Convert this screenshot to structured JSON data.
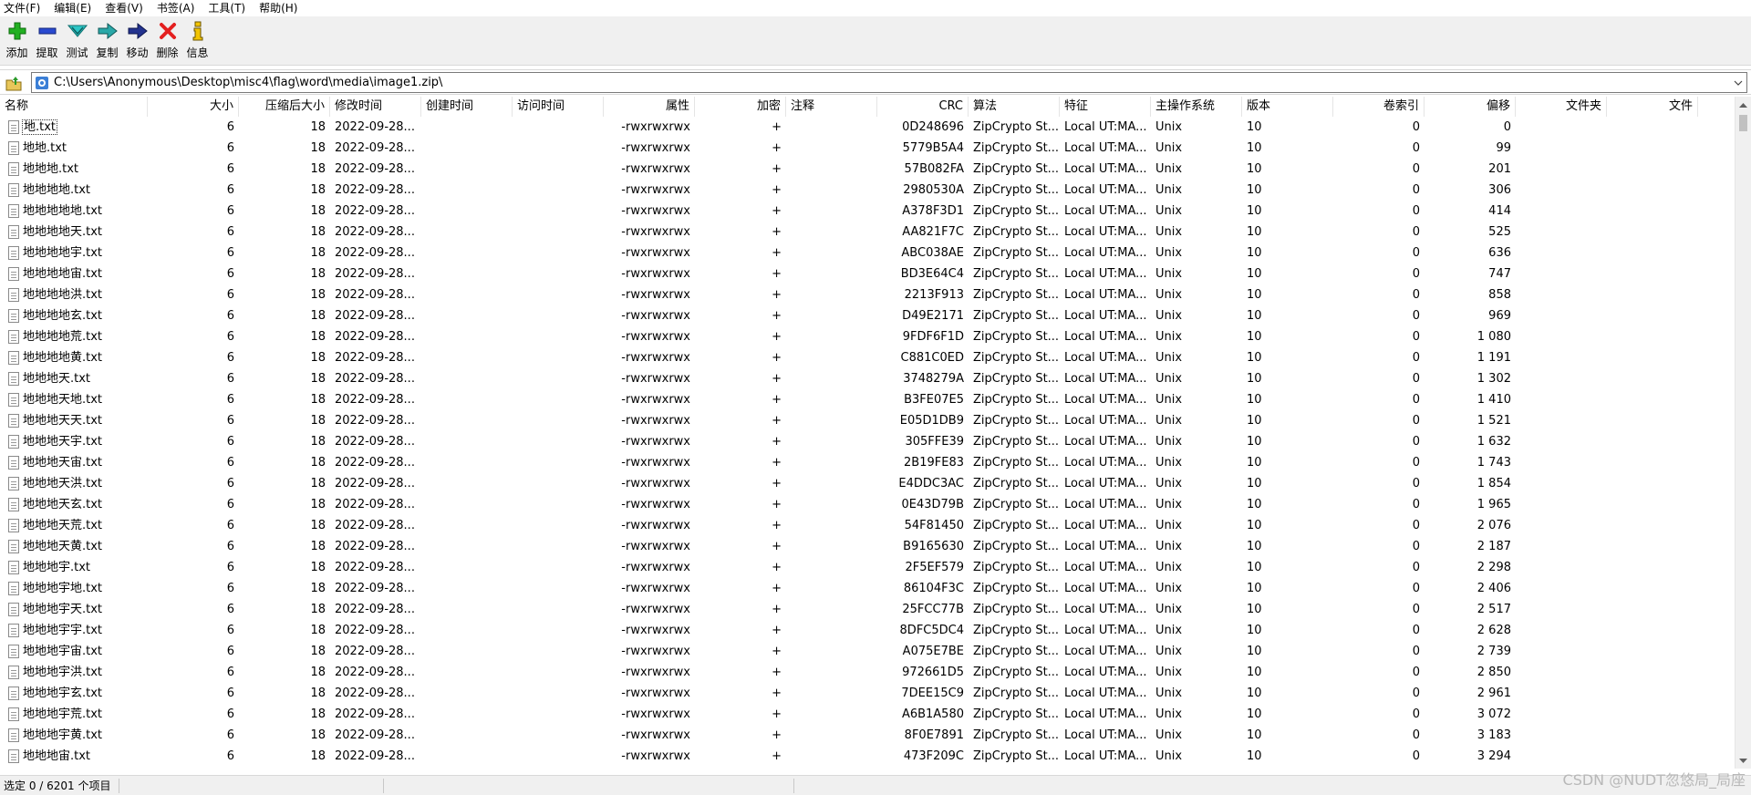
{
  "menu": [
    "文件(F)",
    "编辑(E)",
    "查看(V)",
    "书签(A)",
    "工具(T)",
    "帮助(H)"
  ],
  "toolbar": [
    {
      "label": "添加",
      "icon": "plus-icon",
      "color": "#1aa01a"
    },
    {
      "label": "提取",
      "icon": "minus-icon",
      "color": "#1f3fb5"
    },
    {
      "label": "测试",
      "icon": "check-icon",
      "color": "#20b0b0"
    },
    {
      "label": "复制",
      "icon": "copy-arrow-icon",
      "color": "#20a0a0"
    },
    {
      "label": "移动",
      "icon": "move-arrow-icon",
      "color": "#1f2f8f"
    },
    {
      "label": "删除",
      "icon": "delete-icon",
      "color": "#e02020"
    },
    {
      "label": "信息",
      "icon": "info-icon",
      "color": "#c8a000"
    }
  ],
  "address": {
    "path": "C:\\Users\\Anonymous\\Desktop\\misc4\\flag\\word\\media\\image1.zip\\"
  },
  "columns": [
    "名称",
    "大小",
    "压缩后大小",
    "修改时间",
    "创建时间",
    "访问时间",
    "属性",
    "加密",
    "注释",
    "CRC",
    "算法",
    "特征",
    "主操作系统",
    "版本",
    "卷索引",
    "偏移",
    "文件夹",
    "文件"
  ],
  "rows": [
    {
      "name": "地.txt",
      "size": "6",
      "packed": "18",
      "modified": "2022-09-28...",
      "attr": "-rwxrwxrwx",
      "enc": "+",
      "crc": "0D248696",
      "method": "ZipCrypto St...",
      "char": "Local UT:MA...",
      "os": "Unix",
      "ver": "10",
      "vol": "0",
      "offset": "0"
    },
    {
      "name": "地地.txt",
      "size": "6",
      "packed": "18",
      "modified": "2022-09-28...",
      "attr": "-rwxrwxrwx",
      "enc": "+",
      "crc": "5779B5A4",
      "method": "ZipCrypto St...",
      "char": "Local UT:MA...",
      "os": "Unix",
      "ver": "10",
      "vol": "0",
      "offset": "99"
    },
    {
      "name": "地地地.txt",
      "size": "6",
      "packed": "18",
      "modified": "2022-09-28...",
      "attr": "-rwxrwxrwx",
      "enc": "+",
      "crc": "57B082FA",
      "method": "ZipCrypto St...",
      "char": "Local UT:MA...",
      "os": "Unix",
      "ver": "10",
      "vol": "0",
      "offset": "201"
    },
    {
      "name": "地地地地.txt",
      "size": "6",
      "packed": "18",
      "modified": "2022-09-28...",
      "attr": "-rwxrwxrwx",
      "enc": "+",
      "crc": "2980530A",
      "method": "ZipCrypto St...",
      "char": "Local UT:MA...",
      "os": "Unix",
      "ver": "10",
      "vol": "0",
      "offset": "306"
    },
    {
      "name": "地地地地地.txt",
      "size": "6",
      "packed": "18",
      "modified": "2022-09-28...",
      "attr": "-rwxrwxrwx",
      "enc": "+",
      "crc": "A378F3D1",
      "method": "ZipCrypto St...",
      "char": "Local UT:MA...",
      "os": "Unix",
      "ver": "10",
      "vol": "0",
      "offset": "414"
    },
    {
      "name": "地地地地天.txt",
      "size": "6",
      "packed": "18",
      "modified": "2022-09-28...",
      "attr": "-rwxrwxrwx",
      "enc": "+",
      "crc": "AA821F7C",
      "method": "ZipCrypto St...",
      "char": "Local UT:MA...",
      "os": "Unix",
      "ver": "10",
      "vol": "0",
      "offset": "525"
    },
    {
      "name": "地地地地宇.txt",
      "size": "6",
      "packed": "18",
      "modified": "2022-09-28...",
      "attr": "-rwxrwxrwx",
      "enc": "+",
      "crc": "ABC038AE",
      "method": "ZipCrypto St...",
      "char": "Local UT:MA...",
      "os": "Unix",
      "ver": "10",
      "vol": "0",
      "offset": "636"
    },
    {
      "name": "地地地地宙.txt",
      "size": "6",
      "packed": "18",
      "modified": "2022-09-28...",
      "attr": "-rwxrwxrwx",
      "enc": "+",
      "crc": "BD3E64C4",
      "method": "ZipCrypto St...",
      "char": "Local UT:MA...",
      "os": "Unix",
      "ver": "10",
      "vol": "0",
      "offset": "747"
    },
    {
      "name": "地地地地洪.txt",
      "size": "6",
      "packed": "18",
      "modified": "2022-09-28...",
      "attr": "-rwxrwxrwx",
      "enc": "+",
      "crc": "2213F913",
      "method": "ZipCrypto St...",
      "char": "Local UT:MA...",
      "os": "Unix",
      "ver": "10",
      "vol": "0",
      "offset": "858"
    },
    {
      "name": "地地地地玄.txt",
      "size": "6",
      "packed": "18",
      "modified": "2022-09-28...",
      "attr": "-rwxrwxrwx",
      "enc": "+",
      "crc": "D49E2171",
      "method": "ZipCrypto St...",
      "char": "Local UT:MA...",
      "os": "Unix",
      "ver": "10",
      "vol": "0",
      "offset": "969"
    },
    {
      "name": "地地地地荒.txt",
      "size": "6",
      "packed": "18",
      "modified": "2022-09-28...",
      "attr": "-rwxrwxrwx",
      "enc": "+",
      "crc": "9FDF6F1D",
      "method": "ZipCrypto St...",
      "char": "Local UT:MA...",
      "os": "Unix",
      "ver": "10",
      "vol": "0",
      "offset": "1 080"
    },
    {
      "name": "地地地地黄.txt",
      "size": "6",
      "packed": "18",
      "modified": "2022-09-28...",
      "attr": "-rwxrwxrwx",
      "enc": "+",
      "crc": "C881C0ED",
      "method": "ZipCrypto St...",
      "char": "Local UT:MA...",
      "os": "Unix",
      "ver": "10",
      "vol": "0",
      "offset": "1 191"
    },
    {
      "name": "地地地天.txt",
      "size": "6",
      "packed": "18",
      "modified": "2022-09-28...",
      "attr": "-rwxrwxrwx",
      "enc": "+",
      "crc": "3748279A",
      "method": "ZipCrypto St...",
      "char": "Local UT:MA...",
      "os": "Unix",
      "ver": "10",
      "vol": "0",
      "offset": "1 302"
    },
    {
      "name": "地地地天地.txt",
      "size": "6",
      "packed": "18",
      "modified": "2022-09-28...",
      "attr": "-rwxrwxrwx",
      "enc": "+",
      "crc": "B3FE07E5",
      "method": "ZipCrypto St...",
      "char": "Local UT:MA...",
      "os": "Unix",
      "ver": "10",
      "vol": "0",
      "offset": "1 410"
    },
    {
      "name": "地地地天天.txt",
      "size": "6",
      "packed": "18",
      "modified": "2022-09-28...",
      "attr": "-rwxrwxrwx",
      "enc": "+",
      "crc": "E05D1DB9",
      "method": "ZipCrypto St...",
      "char": "Local UT:MA...",
      "os": "Unix",
      "ver": "10",
      "vol": "0",
      "offset": "1 521"
    },
    {
      "name": "地地地天宇.txt",
      "size": "6",
      "packed": "18",
      "modified": "2022-09-28...",
      "attr": "-rwxrwxrwx",
      "enc": "+",
      "crc": "305FFE39",
      "method": "ZipCrypto St...",
      "char": "Local UT:MA...",
      "os": "Unix",
      "ver": "10",
      "vol": "0",
      "offset": "1 632"
    },
    {
      "name": "地地地天宙.txt",
      "size": "6",
      "packed": "18",
      "modified": "2022-09-28...",
      "attr": "-rwxrwxrwx",
      "enc": "+",
      "crc": "2B19FE83",
      "method": "ZipCrypto St...",
      "char": "Local UT:MA...",
      "os": "Unix",
      "ver": "10",
      "vol": "0",
      "offset": "1 743"
    },
    {
      "name": "地地地天洪.txt",
      "size": "6",
      "packed": "18",
      "modified": "2022-09-28...",
      "attr": "-rwxrwxrwx",
      "enc": "+",
      "crc": "E4DDC3AC",
      "method": "ZipCrypto St...",
      "char": "Local UT:MA...",
      "os": "Unix",
      "ver": "10",
      "vol": "0",
      "offset": "1 854"
    },
    {
      "name": "地地地天玄.txt",
      "size": "6",
      "packed": "18",
      "modified": "2022-09-28...",
      "attr": "-rwxrwxrwx",
      "enc": "+",
      "crc": "0E43D79B",
      "method": "ZipCrypto St...",
      "char": "Local UT:MA...",
      "os": "Unix",
      "ver": "10",
      "vol": "0",
      "offset": "1 965"
    },
    {
      "name": "地地地天荒.txt",
      "size": "6",
      "packed": "18",
      "modified": "2022-09-28...",
      "attr": "-rwxrwxrwx",
      "enc": "+",
      "crc": "54F81450",
      "method": "ZipCrypto St...",
      "char": "Local UT:MA...",
      "os": "Unix",
      "ver": "10",
      "vol": "0",
      "offset": "2 076"
    },
    {
      "name": "地地地天黄.txt",
      "size": "6",
      "packed": "18",
      "modified": "2022-09-28...",
      "attr": "-rwxrwxrwx",
      "enc": "+",
      "crc": "B9165630",
      "method": "ZipCrypto St...",
      "char": "Local UT:MA...",
      "os": "Unix",
      "ver": "10",
      "vol": "0",
      "offset": "2 187"
    },
    {
      "name": "地地地宇.txt",
      "size": "6",
      "packed": "18",
      "modified": "2022-09-28...",
      "attr": "-rwxrwxrwx",
      "enc": "+",
      "crc": "2F5EF579",
      "method": "ZipCrypto St...",
      "char": "Local UT:MA...",
      "os": "Unix",
      "ver": "10",
      "vol": "0",
      "offset": "2 298"
    },
    {
      "name": "地地地宇地.txt",
      "size": "6",
      "packed": "18",
      "modified": "2022-09-28...",
      "attr": "-rwxrwxrwx",
      "enc": "+",
      "crc": "86104F3C",
      "method": "ZipCrypto St...",
      "char": "Local UT:MA...",
      "os": "Unix",
      "ver": "10",
      "vol": "0",
      "offset": "2 406"
    },
    {
      "name": "地地地宇天.txt",
      "size": "6",
      "packed": "18",
      "modified": "2022-09-28...",
      "attr": "-rwxrwxrwx",
      "enc": "+",
      "crc": "25FCC77B",
      "method": "ZipCrypto St...",
      "char": "Local UT:MA...",
      "os": "Unix",
      "ver": "10",
      "vol": "0",
      "offset": "2 517"
    },
    {
      "name": "地地地宇宇.txt",
      "size": "6",
      "packed": "18",
      "modified": "2022-09-28...",
      "attr": "-rwxrwxrwx",
      "enc": "+",
      "crc": "8DFC5DC4",
      "method": "ZipCrypto St...",
      "char": "Local UT:MA...",
      "os": "Unix",
      "ver": "10",
      "vol": "0",
      "offset": "2 628"
    },
    {
      "name": "地地地宇宙.txt",
      "size": "6",
      "packed": "18",
      "modified": "2022-09-28...",
      "attr": "-rwxrwxrwx",
      "enc": "+",
      "crc": "A075E7BE",
      "method": "ZipCrypto St...",
      "char": "Local UT:MA...",
      "os": "Unix",
      "ver": "10",
      "vol": "0",
      "offset": "2 739"
    },
    {
      "name": "地地地宇洪.txt",
      "size": "6",
      "packed": "18",
      "modified": "2022-09-28...",
      "attr": "-rwxrwxrwx",
      "enc": "+",
      "crc": "972661D5",
      "method": "ZipCrypto St...",
      "char": "Local UT:MA...",
      "os": "Unix",
      "ver": "10",
      "vol": "0",
      "offset": "2 850"
    },
    {
      "name": "地地地宇玄.txt",
      "size": "6",
      "packed": "18",
      "modified": "2022-09-28...",
      "attr": "-rwxrwxrwx",
      "enc": "+",
      "crc": "7DEE15C9",
      "method": "ZipCrypto St...",
      "char": "Local UT:MA...",
      "os": "Unix",
      "ver": "10",
      "vol": "0",
      "offset": "2 961"
    },
    {
      "name": "地地地宇荒.txt",
      "size": "6",
      "packed": "18",
      "modified": "2022-09-28...",
      "attr": "-rwxrwxrwx",
      "enc": "+",
      "crc": "A6B1A580",
      "method": "ZipCrypto St...",
      "char": "Local UT:MA...",
      "os": "Unix",
      "ver": "10",
      "vol": "0",
      "offset": "3 072"
    },
    {
      "name": "地地地宇黄.txt",
      "size": "6",
      "packed": "18",
      "modified": "2022-09-28...",
      "attr": "-rwxrwxrwx",
      "enc": "+",
      "crc": "8F0E7891",
      "method": "ZipCrypto St...",
      "char": "Local UT:MA...",
      "os": "Unix",
      "ver": "10",
      "vol": "0",
      "offset": "3 183"
    },
    {
      "name": "地地地宙.txt",
      "size": "6",
      "packed": "18",
      "modified": "2022-09-28...",
      "attr": "-rwxrwxrwx",
      "enc": "+",
      "crc": "473F209C",
      "method": "ZipCrypto St...",
      "char": "Local UT:MA...",
      "os": "Unix",
      "ver": "10",
      "vol": "0",
      "offset": "3 294"
    }
  ],
  "status": {
    "selection": "选定 0 / 6201 个项目"
  },
  "watermark": "CSDN @NUDT忽悠局_局座"
}
